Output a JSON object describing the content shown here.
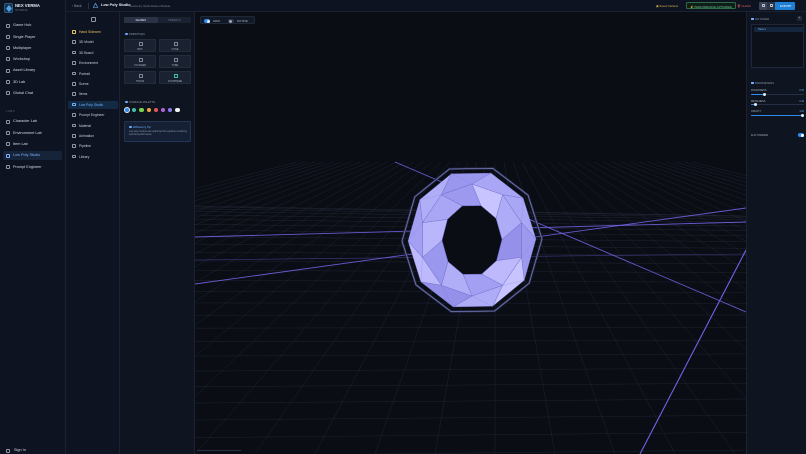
{
  "brand": {
    "name": "NEX VERMA",
    "subtitle": "STUDIOS"
  },
  "app_nav": {
    "items": [
      {
        "label": "Game Hub",
        "icon": "gamepad-icon"
      },
      {
        "label": "Single Player",
        "icon": "user-icon"
      },
      {
        "label": "Multiplayer",
        "icon": "users-icon"
      },
      {
        "label": "Workshop",
        "icon": "wrench-icon"
      },
      {
        "label": "Asset Library",
        "icon": "library-icon"
      },
      {
        "label": "3D Lab",
        "icon": "cube-icon"
      },
      {
        "label": "Global Chat",
        "icon": "chat-icon"
      }
    ],
    "labs_label": "LABS",
    "labs": [
      {
        "label": "Character Lab",
        "icon": "character-icon",
        "active": false
      },
      {
        "label": "Environment Lab",
        "icon": "mountain-icon",
        "active": false
      },
      {
        "label": "Item Lab",
        "icon": "item-icon",
        "active": false
      },
      {
        "label": "Low Poly Studio",
        "icon": "polygon-icon",
        "active": true
      },
      {
        "label": "Prompt Engineer",
        "icon": "prompt-icon",
        "active": false
      }
    ],
    "sign_in": "Sign In"
  },
  "topbar": {
    "back": "Back",
    "title": "Low Poly Studio",
    "subtitle": "Geometry Optimization Module",
    "saved_label": "Saved Variants",
    "perf_label": "PERFORMANCE OPTIMIZED",
    "clear_label": "CLEAR",
    "export_label": "EXPORT"
  },
  "sub_nav": {
    "items": [
      {
        "label": "Hand Sidearm",
        "style": "gold"
      },
      {
        "label": "3D Model",
        "style": "normal"
      },
      {
        "label": "3D Board",
        "style": "normal"
      },
      {
        "label": "Environment",
        "style": "normal"
      },
      {
        "label": "Portrait",
        "style": "normal"
      },
      {
        "label": "Scene",
        "style": "normal"
      },
      {
        "label": "Items",
        "style": "normal"
      },
      {
        "label": "Low Poly Studio",
        "style": "active"
      },
      {
        "label": "Prompt Engineer",
        "style": "normal"
      },
      {
        "label": "Material",
        "style": "normal"
      },
      {
        "label": "Animation",
        "style": "normal"
      },
      {
        "label": "Pipeline",
        "style": "normal"
      },
      {
        "label": "Library",
        "style": "normal"
      }
    ]
  },
  "tool_panel": {
    "tabs": [
      "SHAPES",
      "PRESETS"
    ],
    "primitives_label": "PRIMITIVES",
    "primitives": [
      {
        "label": "BOX",
        "accent": false
      },
      {
        "label": "CONE",
        "accent": false
      },
      {
        "label": "CYLINDER",
        "accent": false
      },
      {
        "label": "TUBE",
        "accent": false
      },
      {
        "label": "TORUS",
        "accent": false
      },
      {
        "label": "ICOSPHERE",
        "accent": true
      }
    ],
    "palette_label": "SURFACE PALETTE",
    "palette": [
      "#2f8bf0",
      "#3fc0a8",
      "#7fd14a",
      "#e8a93a",
      "#e05a5a",
      "#b760e0",
      "#8a7cf0",
      "#f2f2f2"
    ],
    "tip_title": "Efficiency Tip",
    "tip_body": "Low poly meshes are optimized for real-time rendering and fast performance."
  },
  "viewport": {
    "grid_label": "GRID",
    "rotate_label": "ROTATE",
    "grid_on": true,
    "rotate_on": false,
    "mesh": "torus",
    "mesh_color": "#a9a6f5",
    "grid_color": "#7a66f0"
  },
  "right_panel": {
    "outliner_label": "OUTLINER",
    "outliner_item": "Torus 1",
    "params_label": "PARAMETERS",
    "params": [
      {
        "label": "ROUGHNESS",
        "value": "0.70",
        "level": 0.25
      },
      {
        "label": "METALNESS",
        "value": "0.10",
        "level": 0.08
      },
      {
        "label": "OPACITY",
        "value": "1.00",
        "level": 1.0
      }
    ],
    "flat_shading_label": "FLAT SHADING",
    "flat_shading_on": true
  }
}
